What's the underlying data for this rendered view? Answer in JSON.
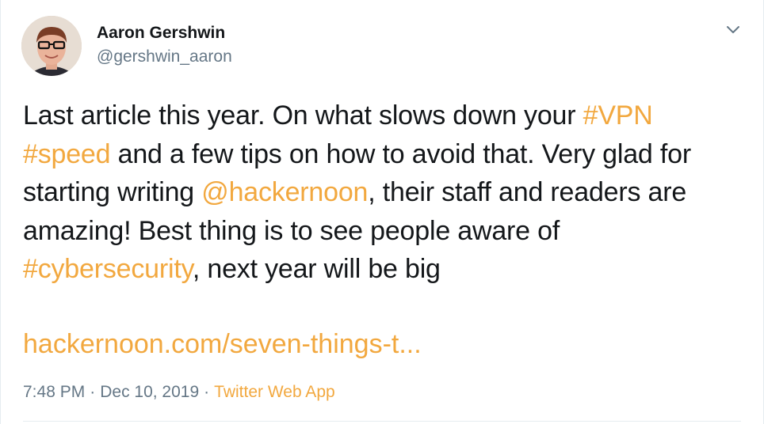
{
  "tweet": {
    "author": {
      "name": "Aaron Gershwin",
      "handle": "@gershwin_aaron"
    },
    "body": {
      "line1_text": "Last article this year. On what slows down your ",
      "line1_tag": "#VPN",
      "line2_tag": "#speed",
      "line2_text": " and a few tips on how to avoid that. Very glad for",
      "line3_text": "starting writing ",
      "line3_mention": "@hackernoon",
      "line3_text2": ", their staff and readers are",
      "line4_text": "amazing! Best thing is to see people aware of",
      "line5_tag": "#cybersecurity",
      "line5_text": ", next year will be big"
    },
    "url": "hackernoon.com/seven-things-t...",
    "meta": {
      "time": "7:48 PM",
      "separator1": "·",
      "date": "Dec 10, 2019",
      "separator2": "·",
      "source": "Twitter Web App"
    }
  },
  "colors": {
    "link": "#f2a83f",
    "text": "#14171a",
    "secondary": "#657786"
  },
  "icons": {
    "more": "chevron-down-icon",
    "avatar": "avatar"
  }
}
